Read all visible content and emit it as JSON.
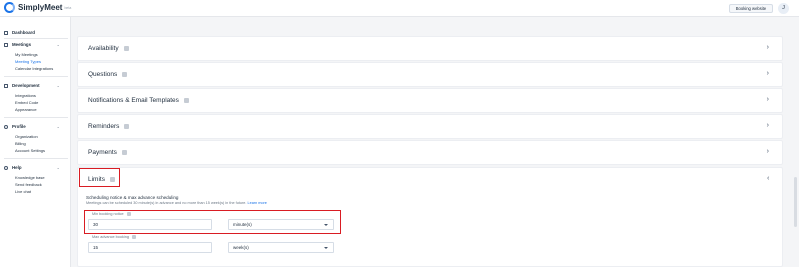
{
  "app": {
    "name": "SimplyMeet",
    "sub": "beta"
  },
  "header": {
    "booking_website": "Booking website",
    "avatar_initial": "J"
  },
  "sidebar": {
    "sections": [
      {
        "label": "Dashboard",
        "icon": "dashboard-icon",
        "items": []
      },
      {
        "label": "Meetings",
        "icon": "calendar-icon",
        "items": [
          "My Meetings",
          "Meeting Types",
          "Calendar Integrations"
        ],
        "active": "Meeting Types"
      },
      {
        "label": "Development",
        "icon": "code-icon",
        "items": [
          "Integrations",
          "Embed Code",
          "Appearance"
        ]
      },
      {
        "label": "Profile",
        "icon": "profile-icon",
        "items": [
          "Organization",
          "Billing",
          "Account Settings"
        ]
      },
      {
        "label": "Help",
        "icon": "help-icon",
        "items": [
          "Knowledge base",
          "Send feedback",
          "Live chat"
        ]
      }
    ]
  },
  "cards": [
    {
      "title": "Availability"
    },
    {
      "title": "Questions"
    },
    {
      "title": "Notifications & Email Templates"
    },
    {
      "title": "Reminders"
    },
    {
      "title": "Payments"
    }
  ],
  "limits": {
    "title": "Limits",
    "section_title": "Scheduling notice & max advance scheduling",
    "section_desc": "Meetings can be scheduled 30 minute(s) in advance and no more than 15 week(s) in the future.",
    "learn_more": "Learn more",
    "min_label": "Min booking notice",
    "min_value": "30",
    "min_unit": "minute(s)",
    "max_label": "Max advance booking",
    "max_value": "15",
    "max_unit": "week(s)"
  },
  "colors": {
    "accent": "#1a73e8",
    "highlight": "#d91c23"
  }
}
